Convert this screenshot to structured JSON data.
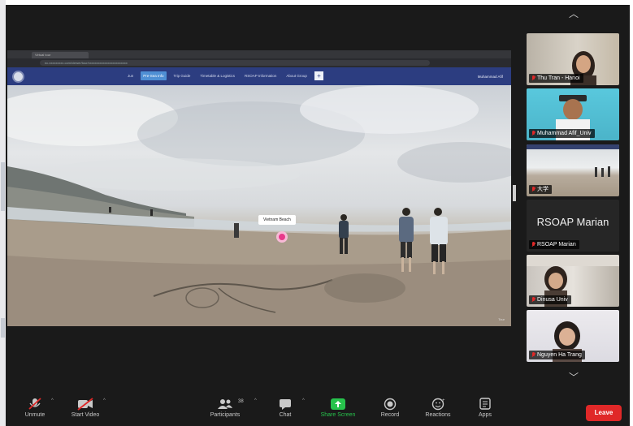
{
  "shared_screen": {
    "browser_tab": "Virtual tour",
    "address": "nc.xxxxxxxxx.com/viewer/tour/xxxxxxxxxxxxxxxxxxxxxxxx",
    "nav_items": [
      "Jun",
      "Pre-Sea Info",
      "Trip Guide",
      "Timetable & Logistics",
      "RSOAP Information",
      "About Group"
    ],
    "active_nav_index": 1,
    "nav_plus": "+",
    "account": "Muhammad Afif",
    "hotspot_label": "Vietnam Beach",
    "watermark": "Tour"
  },
  "participants": {
    "up_arrow": "︿",
    "down_arrow": "﹀",
    "tiles": [
      {
        "name": "Thu Tran - Hanoi",
        "muted": true,
        "speaking": false,
        "kind": "video-warm"
      },
      {
        "name": "Muhammad Afif_Univ",
        "muted": true,
        "speaking": true,
        "kind": "video-cyan"
      },
      {
        "name": "大学",
        "muted": true,
        "speaking": false,
        "kind": "video-beach"
      },
      {
        "name": "RSOAP Marian",
        "muted": true,
        "speaking": false,
        "kind": "name-only",
        "display_name": "RSOAP Marian"
      },
      {
        "name": "Dinusa Univ",
        "muted": true,
        "speaking": false,
        "kind": "video-room"
      },
      {
        "name": "Nguyen Ha Trang",
        "muted": true,
        "speaking": false,
        "kind": "video-light"
      }
    ]
  },
  "toolbar": {
    "unmute": "Unmute",
    "start_video": "Start Video",
    "participants": "Participants",
    "participants_count": "38",
    "chat": "Chat",
    "share_screen": "Share Screen",
    "record": "Record",
    "reactions": "Reactions",
    "apps": "Apps",
    "leave": "Leave",
    "caret": "^"
  },
  "colors": {
    "window_bg": "#1a1a1a",
    "site_nav": "#2c3d80",
    "active_nav": "#4f8fd4",
    "hotspot": "#e8398a",
    "speaking_outline": "#2fc24d",
    "share_green": "#27c24c",
    "leave_red": "#e02828"
  }
}
